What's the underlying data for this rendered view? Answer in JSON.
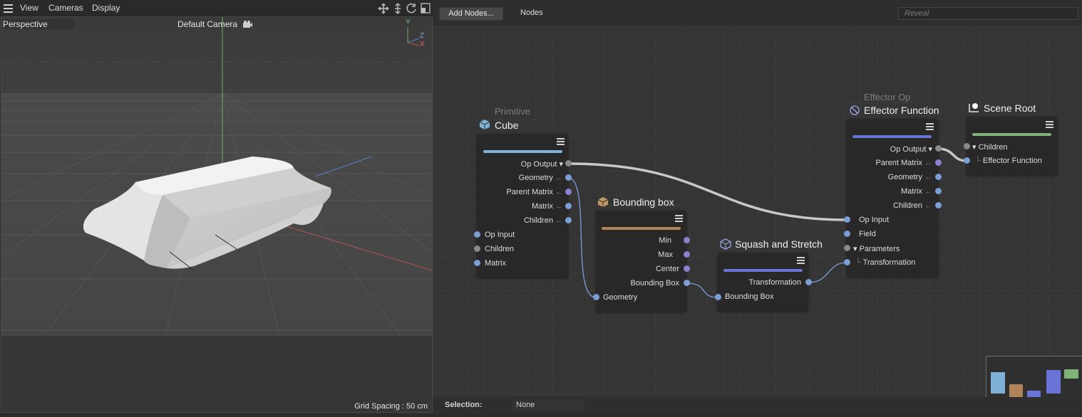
{
  "viewport": {
    "menu": [
      "View",
      "Cameras",
      "Display"
    ],
    "view_name": "Perspective",
    "camera_name": "Default Camera",
    "axis_labels": {
      "y": "Y",
      "z": "Z",
      "x": "X"
    },
    "grid_spacing": "Grid Spacing : 50 cm"
  },
  "editor": {
    "add_nodes_label": "Add Nodes...",
    "nodes_label": "Nodes",
    "search_placeholder": "Reveal",
    "selection_label": "Selection:",
    "selection_value": "None"
  },
  "nodes": {
    "cube": {
      "subtitle": "Primitive",
      "title": "Cube",
      "bar_color": "#7fb2d6",
      "outputs": [
        "Op Output",
        "Geometry",
        "Parent Matrix",
        "Matrix",
        "Children"
      ],
      "inputs": [
        "Op Input",
        "Children",
        "Matrix"
      ]
    },
    "bbox": {
      "title": "Bounding box",
      "bar_color": "#b0845a",
      "outputs": [
        "Min",
        "Max",
        "Center",
        "Bounding Box"
      ],
      "inputs": [
        "Geometry"
      ]
    },
    "squash": {
      "title": "Squash and Stretch",
      "bar_color": "#6a74d6",
      "outputs": [
        "Transformation"
      ],
      "inputs": [
        "Bounding Box"
      ]
    },
    "effector": {
      "subtitle": "Effector Op",
      "title": "Effector Function",
      "bar_color": "#6a74d6",
      "outputs": [
        "Op Output",
        "Parent Matrix",
        "Geometry",
        "Matrix",
        "Children"
      ],
      "inputs": [
        "Op Input",
        "Field",
        "Parameters",
        "Transformation"
      ]
    },
    "sceneroot": {
      "title": "Scene Root",
      "bar_color": "#7fb37a",
      "inputs": [
        "Children",
        "Effector Function"
      ]
    }
  },
  "colors": {
    "accent_blue": "#7b9fd4",
    "port_purple": "#8e7fd0",
    "wire_main": "#c8c8c8"
  },
  "icons": [
    "hamburger-menu-icon",
    "move-icon",
    "scale-icon",
    "rotate-icon",
    "maximize-icon",
    "camera-icon",
    "cube-icon",
    "bbox-icon",
    "squash-icon",
    "effector-icon",
    "scene-root-icon",
    "node-menu-icon"
  ]
}
